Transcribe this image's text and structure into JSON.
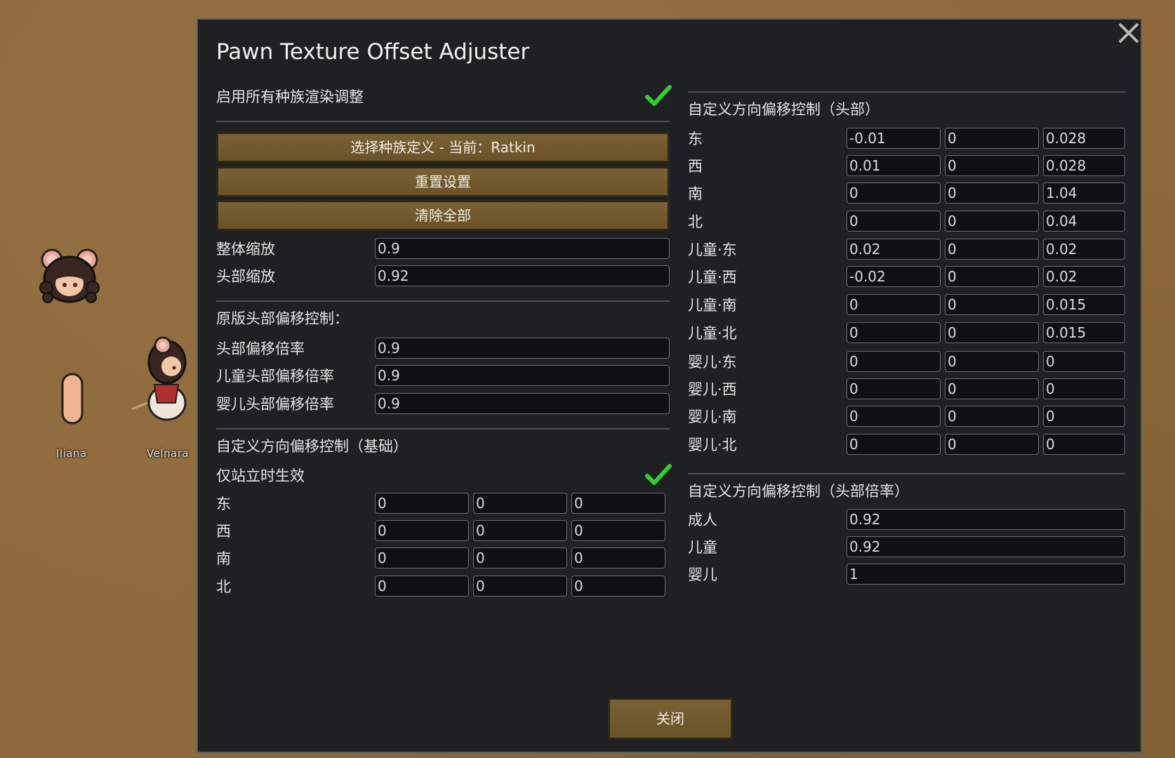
{
  "map": {
    "pawns": [
      {
        "name": "Iliana"
      },
      {
        "name": "Velnara"
      }
    ]
  },
  "dialog": {
    "title": "Pawn Texture Offset Adjuster",
    "enable_all_label": "启用所有种族渲染调整",
    "enable_all_checked": true,
    "race_button": "选择种族定义 - 当前：Ratkin",
    "reset_button": "重置设置",
    "clear_button": "清除全部",
    "overall_scale_label": "整体缩放",
    "overall_scale_value": "0.9",
    "head_scale_label": "头部缩放",
    "head_scale_value": "0.92",
    "vanilla_head_title": "原版头部偏移控制：",
    "head_offset_mult_label": "头部偏移倍率",
    "head_offset_mult_value": "0.9",
    "child_head_offset_mult_label": "儿童头部偏移倍率",
    "child_head_offset_mult_value": "0.9",
    "baby_head_offset_mult_label": "婴儿头部偏移倍率",
    "baby_head_offset_mult_value": "0.9",
    "base_title": "自定义方向偏移控制（基础）",
    "standing_only_label": "仅站立时生效",
    "standing_only_checked": true,
    "base_rows": [
      {
        "label": "东",
        "values": [
          "0",
          "0",
          "0"
        ]
      },
      {
        "label": "西",
        "values": [
          "0",
          "0",
          "0"
        ]
      },
      {
        "label": "南",
        "values": [
          "0",
          "0",
          "0"
        ]
      },
      {
        "label": "北",
        "values": [
          "0",
          "0",
          "0"
        ]
      }
    ],
    "head_title": "自定义方向偏移控制（头部）",
    "head_rows": [
      {
        "label": "东",
        "values": [
          "-0.01",
          "0",
          "0.028"
        ]
      },
      {
        "label": "西",
        "values": [
          "0.01",
          "0",
          "0.028"
        ]
      },
      {
        "label": "南",
        "values": [
          "0",
          "0",
          "1.04"
        ]
      },
      {
        "label": "北",
        "values": [
          "0",
          "0",
          "0.04"
        ]
      },
      {
        "label": "儿童·东",
        "values": [
          "0.02",
          "0",
          "0.02"
        ]
      },
      {
        "label": "儿童·西",
        "values": [
          "-0.02",
          "0",
          "0.02"
        ]
      },
      {
        "label": "儿童·南",
        "values": [
          "0",
          "0",
          "0.015"
        ]
      },
      {
        "label": "儿童·北",
        "values": [
          "0",
          "0",
          "0.015"
        ]
      },
      {
        "label": "婴儿·东",
        "values": [
          "0",
          "0",
          "0"
        ]
      },
      {
        "label": "婴儿·西",
        "values": [
          "0",
          "0",
          "0"
        ]
      },
      {
        "label": "婴儿·南",
        "values": [
          "0",
          "0",
          "0"
        ]
      },
      {
        "label": "婴儿·北",
        "values": [
          "0",
          "0",
          "0"
        ]
      }
    ],
    "head_mult_title": "自定义方向偏移控制（头部倍率）",
    "head_mult_rows": [
      {
        "label": "成人",
        "value": "0.92"
      },
      {
        "label": "儿童",
        "value": "0.92"
      },
      {
        "label": "婴儿",
        "value": "1"
      }
    ],
    "close_button": "关闭"
  },
  "colors": {
    "background": "#8f6a3c",
    "dialog_bg": "#1e2022",
    "button": "#745b31",
    "check": "#2fd12f",
    "field_bg": "#0f1012"
  },
  "icons": [
    "close-icon",
    "checkmark-icon"
  ]
}
